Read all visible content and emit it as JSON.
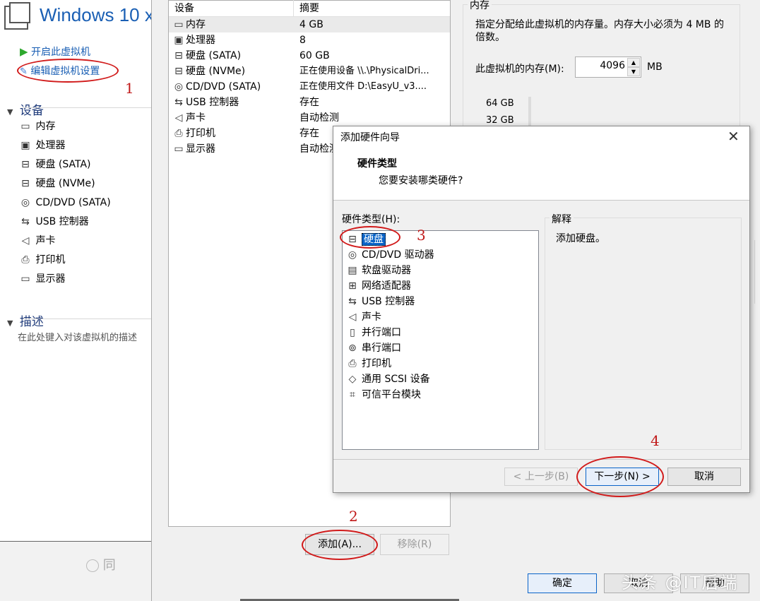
{
  "left": {
    "vm_title": "Windows 10 x",
    "actions": [
      "开启此虚拟机",
      "编辑虚拟机设置"
    ],
    "devices_header": "设备",
    "devices": [
      {
        "label": "内存",
        "icon": "memory-icon"
      },
      {
        "label": "处理器",
        "icon": "cpu-icon"
      },
      {
        "label": "硬盘 (SATA)",
        "icon": "disk-icon"
      },
      {
        "label": "硬盘 (NVMe)",
        "icon": "disk-icon"
      },
      {
        "label": "CD/DVD (SATA)",
        "icon": "cdrom-icon"
      },
      {
        "label": "USB 控制器",
        "icon": "usb-icon"
      },
      {
        "label": "声卡",
        "icon": "speaker-icon"
      },
      {
        "label": "打印机",
        "icon": "printer-icon"
      },
      {
        "label": "显示器",
        "icon": "monitor-icon"
      }
    ],
    "desc_header": "描述",
    "desc_placeholder": "在此处键入对该虚拟机的描述",
    "bottom_radio": "同"
  },
  "settings": {
    "table_headers": [
      "设备",
      "摘要"
    ],
    "rows": [
      {
        "device": "内存",
        "summary": "4 GB",
        "icon": "memory-icon"
      },
      {
        "device": "处理器",
        "summary": "8",
        "icon": "cpu-icon"
      },
      {
        "device": "硬盘 (SATA)",
        "summary": "60 GB",
        "icon": "disk-icon"
      },
      {
        "device": "硬盘 (NVMe)",
        "summary": "正在使用设备 \\\\.\\PhysicalDri...",
        "icon": "disk-icon"
      },
      {
        "device": "CD/DVD (SATA)",
        "summary": "正在使用文件 D:\\EasyU_v3....",
        "icon": "cdrom-icon"
      },
      {
        "device": "USB 控制器",
        "summary": "存在",
        "icon": "usb-icon"
      },
      {
        "device": "声卡",
        "summary": "自动检测",
        "icon": "speaker-icon"
      },
      {
        "device": "打印机",
        "summary": "存在",
        "icon": "printer-icon"
      },
      {
        "device": "显示器",
        "summary": "自动检测",
        "icon": "monitor-icon"
      }
    ],
    "add_button": "添加(A)...",
    "remove_button": "移除(R)",
    "memory": {
      "group_title": "内存",
      "desc": "指定分配给此虚拟机的内存量。内存大小必须为 4 MB 的倍数。",
      "label": "此虚拟机的内存(M):",
      "value": "4096",
      "unit": "MB",
      "scale": [
        "64 GB",
        "32 GB"
      ]
    },
    "ok_button": "确定",
    "cancel_button": "取消",
    "help_button": "帮助"
  },
  "wizard": {
    "title": "添加硬件向导",
    "heading": "硬件类型",
    "subheading": "您要安装哪类硬件?",
    "list_label": "硬件类型(H):",
    "explain_label": "解释",
    "explain_text": "添加硬盘。",
    "items": [
      {
        "label": "硬盘",
        "icon": "disk-icon"
      },
      {
        "label": "CD/DVD 驱动器",
        "icon": "cdrom-icon"
      },
      {
        "label": "软盘驱动器",
        "icon": "floppy-icon"
      },
      {
        "label": "网络适配器",
        "icon": "network-icon"
      },
      {
        "label": "USB 控制器",
        "icon": "usb-icon"
      },
      {
        "label": "声卡",
        "icon": "speaker-icon"
      },
      {
        "label": "并行端口",
        "icon": "parallel-port-icon"
      },
      {
        "label": "串行端口",
        "icon": "serial-port-icon"
      },
      {
        "label": "打印机",
        "icon": "printer-icon"
      },
      {
        "label": "通用 SCSI 设备",
        "icon": "scsi-icon"
      },
      {
        "label": "可信平台模块",
        "icon": "tpm-icon"
      }
    ],
    "back_button": "< 上一步(B)",
    "next_button": "下一步(N) >",
    "cancel_button": "取消"
  },
  "annotations": [
    "1",
    "2",
    "3",
    "4"
  ],
  "watermark": "头条 @IT后端"
}
